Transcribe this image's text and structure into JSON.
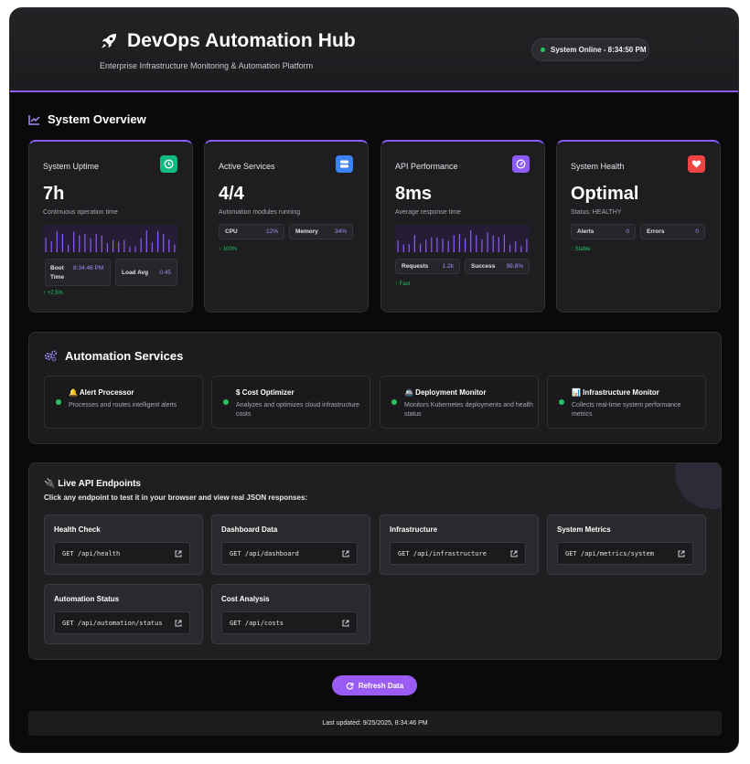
{
  "header": {
    "title": "DevOps Automation Hub",
    "subtitle": "Enterprise Infrastructure Monitoring & Automation Platform",
    "status": "System Online - 8:34:50 PM",
    "icon": "rocket-icon"
  },
  "overview": {
    "title": "System Overview",
    "icon": "chart-line-icon",
    "cards": {
      "uptime": {
        "label": "System Uptime",
        "value": "7h",
        "sub": "Continuous operation time",
        "icon": "clock-icon",
        "icon_color": "#10b981",
        "boot_label": "Boot Time",
        "boot_value": "8:34:46 PM",
        "load_label": "Load Avg",
        "load_value": "0.45",
        "trend": "↑ +2.5%"
      },
      "services": {
        "label": "Active Services",
        "value": "4/4",
        "sub": "Automation modules running",
        "icon": "server-icon",
        "icon_color": "#3b82f6",
        "cpu_label": "CPU",
        "cpu_value": "12%",
        "mem_label": "Memory",
        "mem_value": "34%",
        "trend": "↑ 100%"
      },
      "api": {
        "label": "API Performance",
        "value": "8ms",
        "sub": "Average response time",
        "icon": "gauge-icon",
        "icon_color": "#8b5cf6",
        "req_label": "Requests",
        "req_value": "1.2k",
        "succ_label": "Success",
        "succ_value": "99.8%",
        "trend": "↑ Fast"
      },
      "health": {
        "label": "System Health",
        "value": "Optimal",
        "sub": "Status: HEALTHY",
        "icon": "heart-icon",
        "icon_color": "#ef4444",
        "alerts_label": "Alerts",
        "alerts_value": "0",
        "errors_label": "Errors",
        "errors_value": "0",
        "trend": "↑ Stable"
      }
    }
  },
  "automation": {
    "title": "Automation Services",
    "icon": "cogs-icon",
    "services": [
      {
        "name": "🔔 Alert Processor",
        "desc": "Processes and routes intelligent alerts"
      },
      {
        "name": "$ Cost Optimizer",
        "desc": "Analyzes and optimizes cloud infrastructure costs"
      },
      {
        "name": "🚢 Deployment Monitor",
        "desc": "Monitors Kubernetes deployments and health status"
      },
      {
        "name": "📊 Infrastructure Monitor",
        "desc": "Collects real-time system performance metrics"
      }
    ]
  },
  "api_endpoints": {
    "title": "🔌 Live API Endpoints",
    "description": "Click any endpoint to test it in your browser and view real JSON responses:",
    "endpoints": [
      {
        "name": "Health Check",
        "url": "GET /api/health"
      },
      {
        "name": "Dashboard Data",
        "url": "GET /api/dashboard"
      },
      {
        "name": "Infrastructure",
        "url": "GET /api/infrastructure"
      },
      {
        "name": "System Metrics",
        "url": "GET /api/metrics/system"
      },
      {
        "name": "Automation Status",
        "url": "GET /api/automation/status"
      },
      {
        "name": "Cost Analysis",
        "url": "GET /api/costs"
      }
    ]
  },
  "refresh_label": "Refresh Data",
  "footer": "Last updated: 9/25/2025, 8:34:46 PM",
  "colors": {
    "accent": "#8b5cf6",
    "online": "#22c55e"
  }
}
